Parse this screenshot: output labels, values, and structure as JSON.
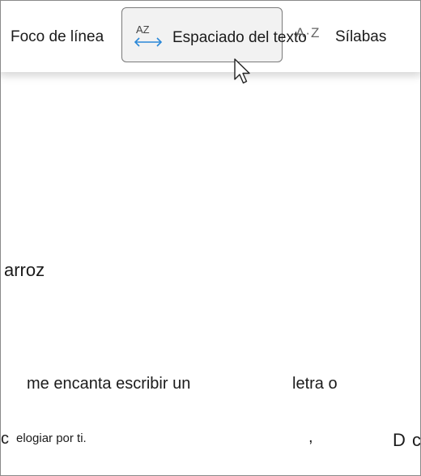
{
  "toolbar": {
    "line_focus_label": "Foco de línea",
    "text_spacing": {
      "label": "Espaciado del texto",
      "icon_text": "AZ"
    },
    "syllables": {
      "label": "Sílabas",
      "icon_text": "A·Z"
    }
  },
  "document": {
    "line1": "arroz",
    "line2a": "me encanta escribir un",
    "line2b": "letra o",
    "line3a": "c",
    "line3b": "elogiar por ti.",
    "line3c": ",",
    "line3d": "D",
    "line3e": "c"
  },
  "colors": {
    "accent": "#2b88d8",
    "button_bg": "#f2f2f2",
    "button_border": "#7a7a7a"
  }
}
